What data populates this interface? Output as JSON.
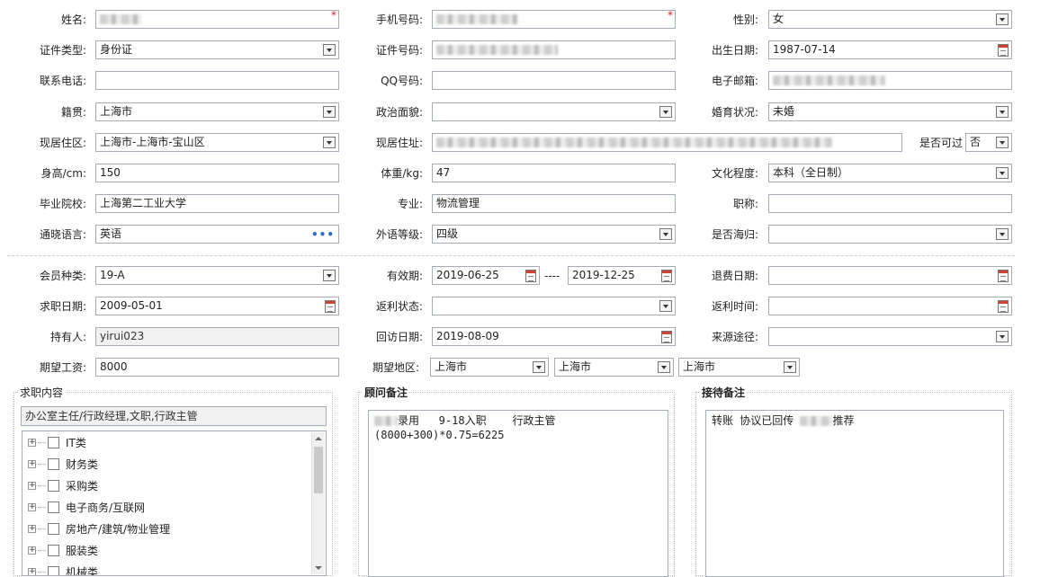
{
  "personal": {
    "name_label": "姓名:",
    "phone_label": "手机号码:",
    "gender_label": "性别:",
    "gender": "女",
    "id_type_label": "证件类型:",
    "id_type": "身份证",
    "id_no_label": "证件号码:",
    "birth_label": "出生日期:",
    "birth": "1987-07-14",
    "contact_label": "联系电话:",
    "qq_label": "QQ号码:",
    "email_label": "电子邮箱:",
    "native_label": "籍贯:",
    "native": "上海市",
    "political_label": "政治面貌:",
    "marital_label": "婚育状况:",
    "marital": "未婚",
    "residence_label": "现居住区:",
    "residence": "上海市-上海市-宝山区",
    "address_label": "现居住址:",
    "reachable_label": "是否可过",
    "reachable": "否",
    "height_label": "身高/cm:",
    "height": "150",
    "weight_label": "体重/kg:",
    "weight": "47",
    "education_label": "文化程度:",
    "education": "本科（全日制）",
    "school_label": "毕业院校:",
    "school": "上海第二工业大学",
    "major_label": "专业:",
    "major": "物流管理",
    "title_label": "职称:",
    "language_label": "通晓语言:",
    "language": "英语",
    "language_more": "•••",
    "foreign_level_label": "外语等级:",
    "foreign_level": "四级",
    "returnee_label": "是否海归:",
    "required_mark": "*"
  },
  "member": {
    "type_label": "会员种类:",
    "type": "19-A",
    "valid_label": "有效期:",
    "valid_from": "2019-06-25",
    "range_sep": "----",
    "valid_to": "2019-12-25",
    "refund_date_label": "退费日期:",
    "job_date_label": "求职日期:",
    "job_date": "2009-05-01",
    "rebate_status_label": "返利状态:",
    "rebate_time_label": "返利时间:",
    "holder_label": "持有人:",
    "holder": "yirui023",
    "visit_label": "回访日期:",
    "visit": "2019-08-09",
    "source_label": "来源途径:",
    "salary_label": "期望工资:",
    "salary": "8000",
    "area_label": "期望地区:",
    "area1": "上海市",
    "area2": "上海市",
    "area3": "上海市"
  },
  "job_content": {
    "legend": "求职内容",
    "summary": "办公室主任/行政经理,文职,行政主管",
    "tree": [
      "IT类",
      "财务类",
      "采购类",
      "电子商务/互联网",
      "房地产/建筑/物业管理",
      "服装类",
      "机械类"
    ]
  },
  "advisor_note": {
    "legend": "顾问备注",
    "line1_a": "录用   9-18入职    行政主管",
    "line2": "(8000+300)*0.75=6225"
  },
  "reception_note": {
    "legend": "接待备注",
    "text_a": "转账 协议已回传 ",
    "text_b": "推荐"
  },
  "colors": {
    "required": "#e02020",
    "border": "#a5acb5",
    "more_dots": "#2a6ac8"
  }
}
